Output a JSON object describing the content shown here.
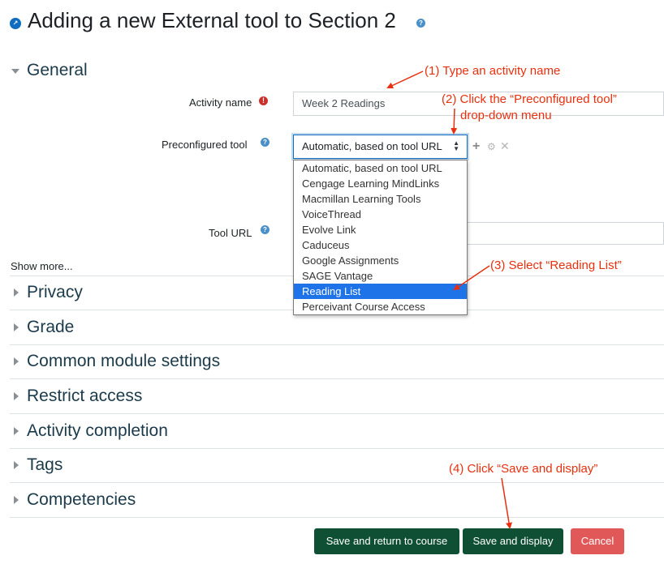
{
  "header": {
    "title": "Adding a new External tool to Section 2"
  },
  "general": {
    "heading": "General",
    "activity_name_label": "Activity name",
    "activity_name_value": "Week 2 Readings",
    "preconfigured_tool_label": "Preconfigured tool",
    "preconfigured_tool_value": "Automatic, based on tool URL",
    "tool_url_label": "Tool URL",
    "show_more": "Show more..."
  },
  "dropdown": {
    "options": [
      "Automatic, based on tool URL",
      "Cengage Learning MindLinks",
      "Macmillan Learning Tools",
      "VoiceThread",
      "Evolve Link",
      "Caduceus",
      "Google Assignments",
      "SAGE Vantage",
      "Reading List",
      "Perceivant Course Access"
    ],
    "selected": "Reading List"
  },
  "sections": [
    "Privacy",
    "Grade",
    "Common module settings",
    "Restrict access",
    "Activity completion",
    "Tags",
    "Competencies"
  ],
  "buttons": {
    "save_return": "Save and return to course",
    "save_display": "Save and display",
    "cancel": "Cancel"
  },
  "annotations": {
    "a1": "(1) Type an activity name",
    "a2_line1": "(2) Click the “Preconfigured tool”",
    "a2_line2": "drop-down menu",
    "a3": "(3) Select “Reading List”",
    "a4": "(4) Click “Save and display”"
  },
  "colors": {
    "primary_green": "#0f4f33",
    "cancel_red": "#e15858",
    "selected_blue": "#1e73e8",
    "annotation_red": "#e8300e",
    "help_blue": "#4a90c8"
  },
  "icons": {
    "title": "module-icon",
    "help": "question-circle-icon",
    "required": "exclamation-circle-icon",
    "add": "plus-icon",
    "configure": "gear-icon",
    "remove": "close-icon"
  }
}
